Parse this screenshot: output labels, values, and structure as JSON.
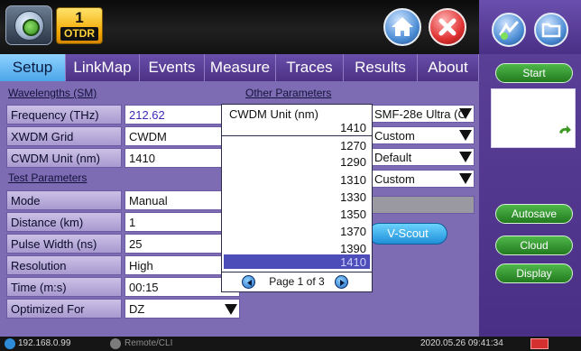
{
  "app": {
    "module_number": "1",
    "module_label": "OTDR"
  },
  "tabs": [
    {
      "label": "Setup",
      "active": true
    },
    {
      "label": "LinkMap",
      "active": false
    },
    {
      "label": "Events",
      "active": false
    },
    {
      "label": "Measure",
      "active": false
    },
    {
      "label": "Traces",
      "active": false
    },
    {
      "label": "Results",
      "active": false
    },
    {
      "label": "About",
      "active": false
    }
  ],
  "sections": {
    "wavelengths": "Wavelengths (SM)",
    "test_parameters": "Test Parameters",
    "other_parameters": "Other Parameters"
  },
  "wavelength_params": [
    {
      "label": "Frequency (THz)",
      "value": "212.62"
    },
    {
      "label": "XWDM Grid",
      "value": "CWDM"
    },
    {
      "label": "CWDM Unit (nm)",
      "value": "1410"
    }
  ],
  "test_params": [
    {
      "label": "Mode",
      "value": "Manual"
    },
    {
      "label": "Distance (km)",
      "value": "1"
    },
    {
      "label": "Pulse Width (ns)",
      "value": "25"
    },
    {
      "label": "Resolution",
      "value": "High"
    },
    {
      "label": "Time (m:s)",
      "value": "00:15"
    },
    {
      "label": "Optimized For",
      "value": "DZ"
    }
  ],
  "other_params": [
    {
      "value": "SMF-28e Ultra (C"
    },
    {
      "value": "Custom"
    },
    {
      "value": "Default"
    },
    {
      "value": "Custom"
    }
  ],
  "vscout_label": "V-Scout",
  "popup": {
    "title": "CWDM Unit (nm)",
    "current_value": "1410",
    "options": [
      "1270",
      "1290",
      "1310",
      "1330",
      "1350",
      "1370",
      "1390",
      "1410"
    ],
    "selected": "1410",
    "page_text": "Page 1 of 3"
  },
  "sidebar": {
    "start": "Start",
    "autosave": "Autosave",
    "cloud": "Cloud",
    "display": "Display"
  },
  "status": {
    "ip": "192.168.0.99",
    "remote": "Remote/CLI",
    "datetime": "2020.05.26  09:41:34"
  },
  "icons": {
    "app_menu": "app-menu-icon",
    "home": "home-icon",
    "exit": "close-icon",
    "favorites": "favorites-icon",
    "files": "folder-icon",
    "refresh": "refresh-icon",
    "page_prev": "page-prev-icon",
    "page_next": "page-next-icon",
    "network": "network-icon",
    "remote": "remote-icon",
    "battery": "battery-icon"
  },
  "colors": {
    "accent_value": "#3b2ab8",
    "active_tab": "#4aa6e8",
    "panel": "#7d6bb4",
    "action_button": "#227a1f",
    "selected_option": "#4d4dba"
  }
}
